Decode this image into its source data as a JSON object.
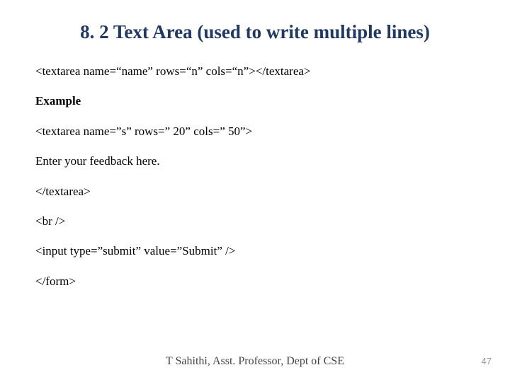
{
  "title": "8. 2 Text Area (used to write multiple lines)",
  "lines": {
    "syntax": "<textarea name=“name” rows=“n” cols=“n”></textarea>",
    "example_label": "Example",
    "ex1": "<textarea name=”s” rows=” 20” cols=” 50”>",
    "ex2": "Enter your feedback here.",
    "ex3": "</textarea>",
    "ex4": "<br />",
    "ex5": "<input type=”submit” value=”Submit” />",
    "ex6": "</form>"
  },
  "footer": {
    "author": "T Sahithi, Asst. Professor, Dept of CSE",
    "page": "47"
  }
}
